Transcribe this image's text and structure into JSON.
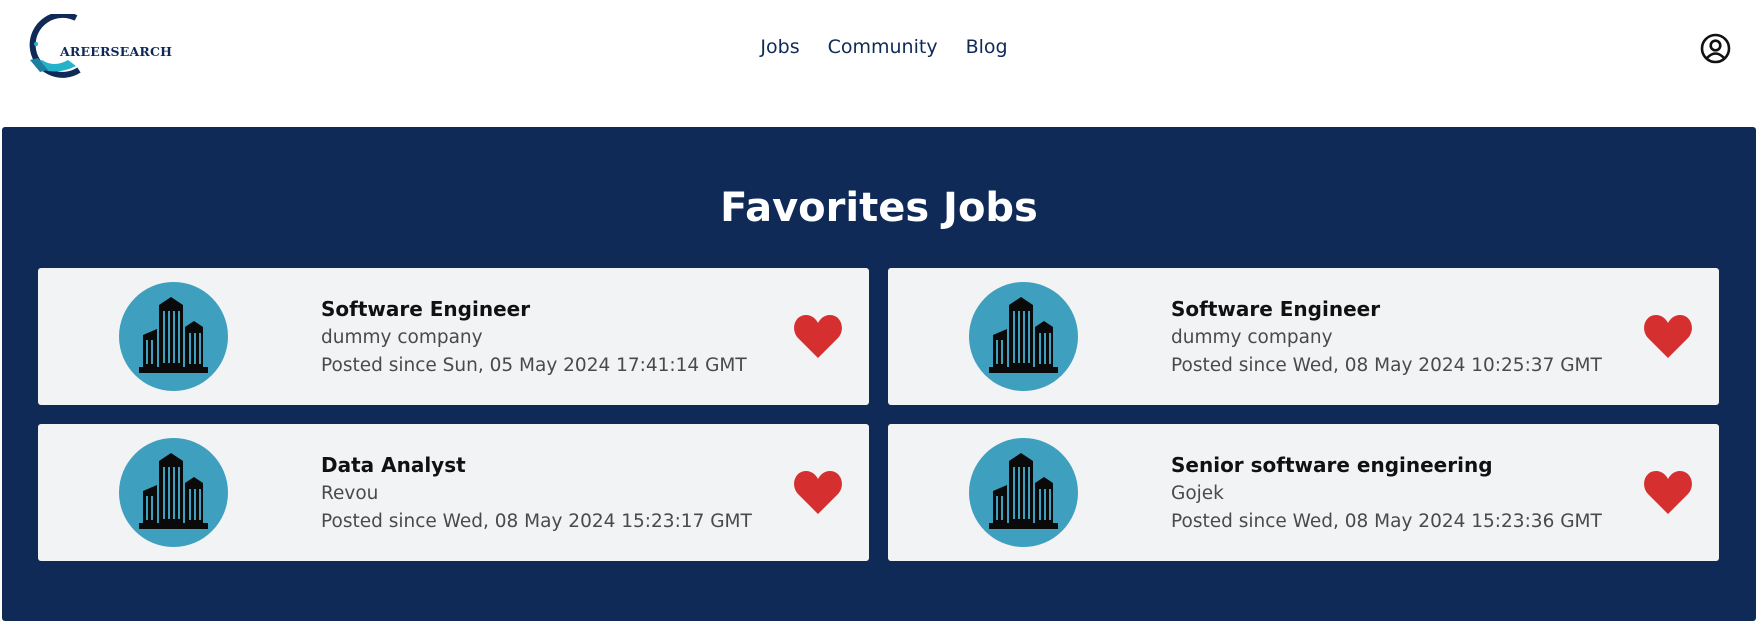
{
  "brand": {
    "logo_text": "AREERSEARCH",
    "accent_color": "#0f2a57"
  },
  "nav": {
    "links": [
      {
        "label": "Jobs"
      },
      {
        "label": "Community"
      },
      {
        "label": "Blog"
      }
    ],
    "profile_icon": "user-circle-icon"
  },
  "favorites": {
    "title": "Favorites Jobs",
    "cards": [
      {
        "title": "Software Engineer",
        "company": "dummy company",
        "posted": "Posted since Sun, 05 May 2024 17:41:14 GMT",
        "icon": "building-icon",
        "favorite_icon": "heart-icon"
      },
      {
        "title": "Software Engineer",
        "company": "dummy company",
        "posted": "Posted since Wed, 08 May 2024 10:25:37 GMT",
        "icon": "building-icon",
        "favorite_icon": "heart-icon"
      },
      {
        "title": "Data Analyst",
        "company": "Revou",
        "posted": "Posted since Wed, 08 May 2024 15:23:17 GMT",
        "icon": "building-icon",
        "favorite_icon": "heart-icon"
      },
      {
        "title": "Senior software engineering",
        "company": "Gojek",
        "posted": "Posted since Wed, 08 May 2024 15:23:36 GMT",
        "icon": "building-icon",
        "favorite_icon": "heart-icon"
      }
    ]
  },
  "colors": {
    "panel_bg": "#0f2a57",
    "card_bg": "#f2f3f5",
    "avatar_bg": "#3f9fbf",
    "heart": "#d62f2f"
  }
}
